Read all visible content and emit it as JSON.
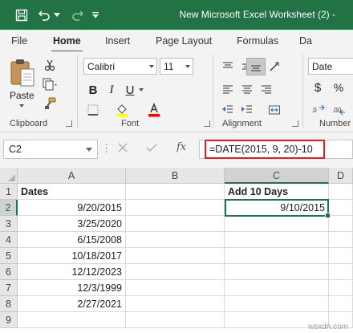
{
  "window": {
    "title": "New Microsoft Excel Worksheet (2)  -"
  },
  "quick_access": [
    {
      "icon": "save-icon"
    },
    {
      "icon": "undo-icon"
    },
    {
      "icon": "undo-dropdown-icon"
    },
    {
      "icon": "redo-icon"
    },
    {
      "icon": "customize-qat-icon"
    }
  ],
  "ribbon_tabs": [
    "File",
    "Home",
    "Insert",
    "Page Layout",
    "Formulas",
    "Da"
  ],
  "active_tab": "Home",
  "ribbon": {
    "clipboard": {
      "label": "Clipboard",
      "paste_label": "Paste"
    },
    "font": {
      "label": "Font",
      "name": "Calibri",
      "size": "11"
    },
    "alignment": {
      "label": "Alignment"
    },
    "number": {
      "label": "Number",
      "format": "Date",
      "currency": "$"
    }
  },
  "formula_bar": {
    "name_box": "C2",
    "formula": "=DATE(2015, 9, 20)-10"
  },
  "colors": {
    "accent": "#217346",
    "highlight": "#e01e1e",
    "fill_swatch": "#ffff00",
    "font_swatch": "#ff0000"
  },
  "sheet": {
    "columns": [
      "A",
      "B",
      "C",
      "D"
    ],
    "rows": [
      "1",
      "2",
      "3",
      "4",
      "5",
      "6",
      "7",
      "8",
      "9"
    ],
    "cells": {
      "A1": "Dates",
      "A2": "9/20/2015",
      "A3": "3/25/2020",
      "A4": "6/15/2008",
      "A5": "10/18/2017",
      "A6": "12/12/2023",
      "A7": "12/3/1999",
      "A8": "2/27/2021",
      "C1": "Add 10 Days",
      "C2": "9/10/2015"
    },
    "active_cell": "C2"
  },
  "watermark": "wsxdn.com"
}
